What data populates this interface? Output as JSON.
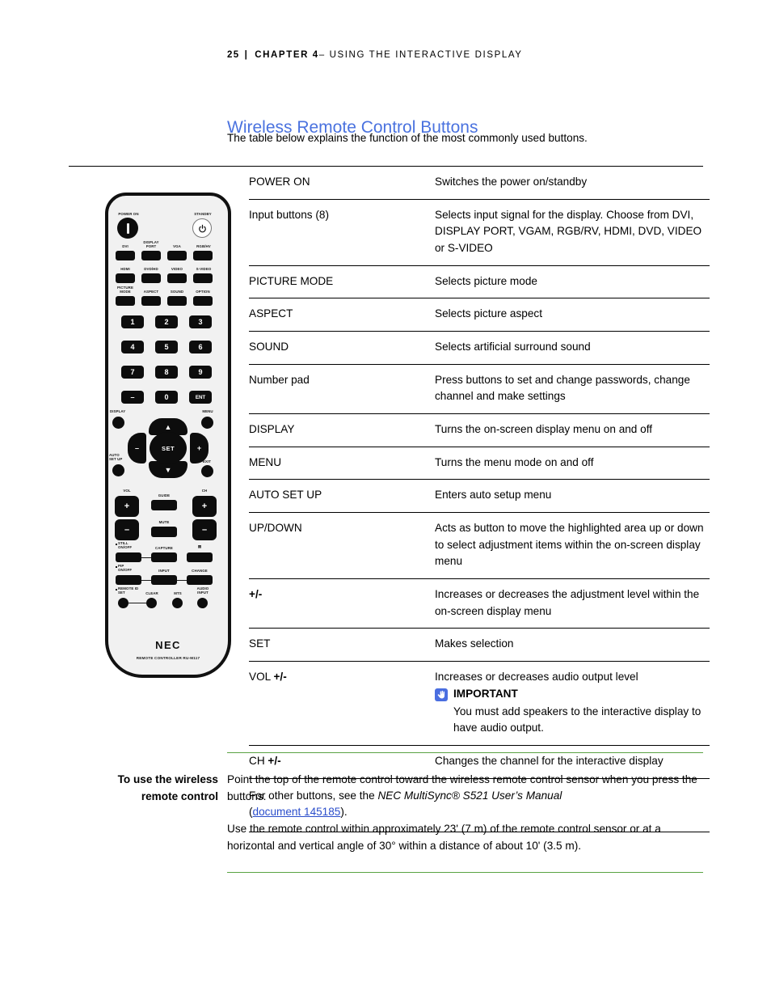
{
  "header": {
    "page_number": "25",
    "separator": "|",
    "chapter_label": "CHAPTER 4",
    "chapter_rest": "– USING THE INTERACTIVE DISPLAY"
  },
  "section": {
    "title": "Wireless Remote Control Buttons",
    "intro": "The table below explains the function of the most commonly used buttons.",
    "title_color": "#4a72df"
  },
  "table": {
    "rows": [
      {
        "button": "POWER ON",
        "description": "Switches the power on/standby"
      },
      {
        "button": "Input buttons (8)",
        "description": "Selects input signal for the display. Choose from DVI, DISPLAY PORT, VGAM, RGB/RV, HDMI, DVD, VIDEO or S-VIDEO"
      },
      {
        "button": "PICTURE MODE",
        "description": "Selects picture mode"
      },
      {
        "button": "ASPECT",
        "description": "Selects picture aspect"
      },
      {
        "button": "SOUND",
        "description": "Selects artificial surround sound"
      },
      {
        "button": "Number pad",
        "description": "Press buttons to set and change passwords, change channel and make settings"
      },
      {
        "button": "DISPLAY",
        "description": "Turns the on-screen display menu on and off"
      },
      {
        "button": "MENU",
        "description": "Turns the menu mode on and off"
      },
      {
        "button": "AUTO SET UP",
        "description": "Enters auto setup menu"
      },
      {
        "button": "UP/DOWN",
        "description": "Acts as button to move the highlighted area up or down to select adjustment items within the on-screen display menu"
      },
      {
        "button": "+/-",
        "button_bold": true,
        "description": "Increases or decreases the adjustment level within the on-screen display menu"
      },
      {
        "button": "SET",
        "description": "Makes selection"
      },
      {
        "button_prefix": "VOL ",
        "button_suffix": "+/-",
        "description": "Increases or decreases audio output level",
        "callout": {
          "icon": "pointing-hand-icon",
          "icon_color": "#4a6ee0",
          "title": "IMPORTANT",
          "body": "You must add speakers to the interactive display to have audio output."
        }
      },
      {
        "button_prefix": "CH ",
        "button_suffix": "+/-",
        "description": "Changes the channel for the interactive display"
      }
    ],
    "footnote": {
      "lead": "For other buttons, see the ",
      "italic": "NEC MultiSync® S521 User’s Manual",
      "mid": " (",
      "link": "document 145185",
      "tail": ")."
    }
  },
  "procedure": {
    "label_line1": "To use the wireless",
    "label_line2": "remote control",
    "paragraph1": "Point the top of the remote control toward the wireless remote control sensor when you press the buttons.",
    "paragraph2": "Use the remote control within approximately 23' (7 m) of the remote control sensor or at a horizontal and vertical angle of 30° within a distance of about 10' (3.5 m).",
    "rule_color": "#5aa343"
  },
  "remote": {
    "power_on_label": "POWER ON",
    "standby_label": "STANDBY",
    "input_row1": [
      "DVI",
      "DISPLAY\nPORT",
      "VGA",
      "RGB/HV"
    ],
    "input_row2": [
      "HDMI",
      "DVD/HD",
      "VIDEO",
      "S-VIDEO"
    ],
    "mode_row": [
      "PICTURE\nMODE",
      "ASPECT",
      "SOUND",
      "OPTION"
    ],
    "keypad": [
      "1",
      "2",
      "3",
      "4",
      "5",
      "6",
      "7",
      "8",
      "9",
      "–",
      "0",
      "ENT"
    ],
    "display_label": "DISPLAY",
    "menu_label": "MENU",
    "auto_setup_label": "AUTO\nSET UP",
    "exit_label": "EXIT",
    "set_label": "SET",
    "minus_label": "–",
    "plus_label": "+",
    "up_label": "▲",
    "down_label": "▼",
    "vol_label": "VOL",
    "ch_label": "CH",
    "guide_label": "GUIDE",
    "mute_label": "MUTE",
    "still_label": "STILL\nON/OFF",
    "capture_label": "CAPTURE",
    "pip_label": "PIP\nON/OFF",
    "input_label": "INPUT",
    "change_label": "CHANGE",
    "remote_id_label": "REMOTE ID\nSET",
    "clear_label": "CLEAR",
    "mts_label": "MTS",
    "audio_input_label": "AUDIO\nINPUT",
    "brand": "NEC",
    "model": "REMOTE CONTROLLER RU-M117"
  }
}
